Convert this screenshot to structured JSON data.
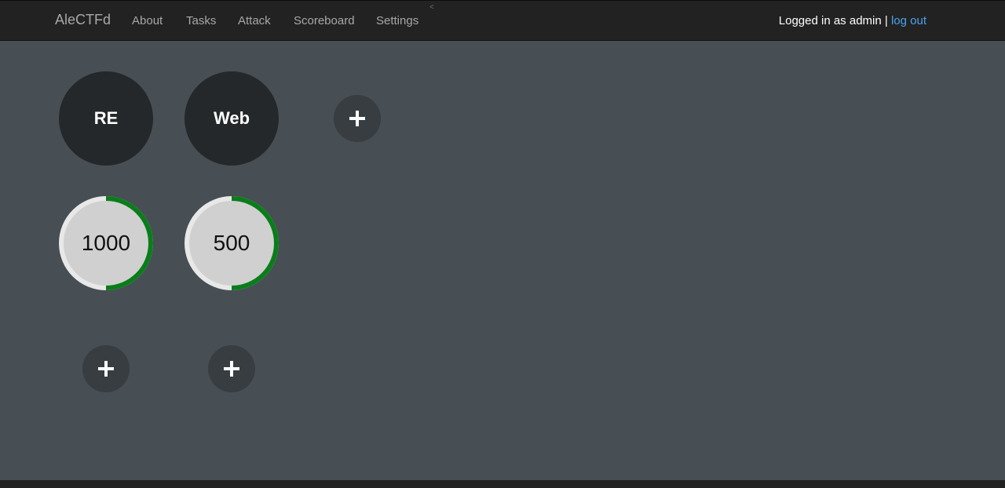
{
  "navbar": {
    "brand": "AleCTFd",
    "links": [
      "About",
      "Tasks",
      "Attack",
      "Scoreboard",
      "Settings"
    ],
    "caret": "<",
    "user_prefix": "Logged in as admin |",
    "logout": "log out"
  },
  "categories": [
    {
      "name": "RE"
    },
    {
      "name": "Web"
    }
  ],
  "tasks": [
    {
      "score": "1000",
      "solved_fraction": 0.5
    },
    {
      "score": "500",
      "solved_fraction": 0.5
    }
  ],
  "colors": {
    "background": "#474e54",
    "navbar": "#222222",
    "category_fill": "#24282b",
    "add_button": "#373d41",
    "task_fill": "#d0d0d0",
    "task_ring_base": "#e8e8e8",
    "task_ring_progress": "#0a7d1a",
    "link": "#4aa3f0"
  },
  "icons": {
    "add": "plus-icon"
  }
}
